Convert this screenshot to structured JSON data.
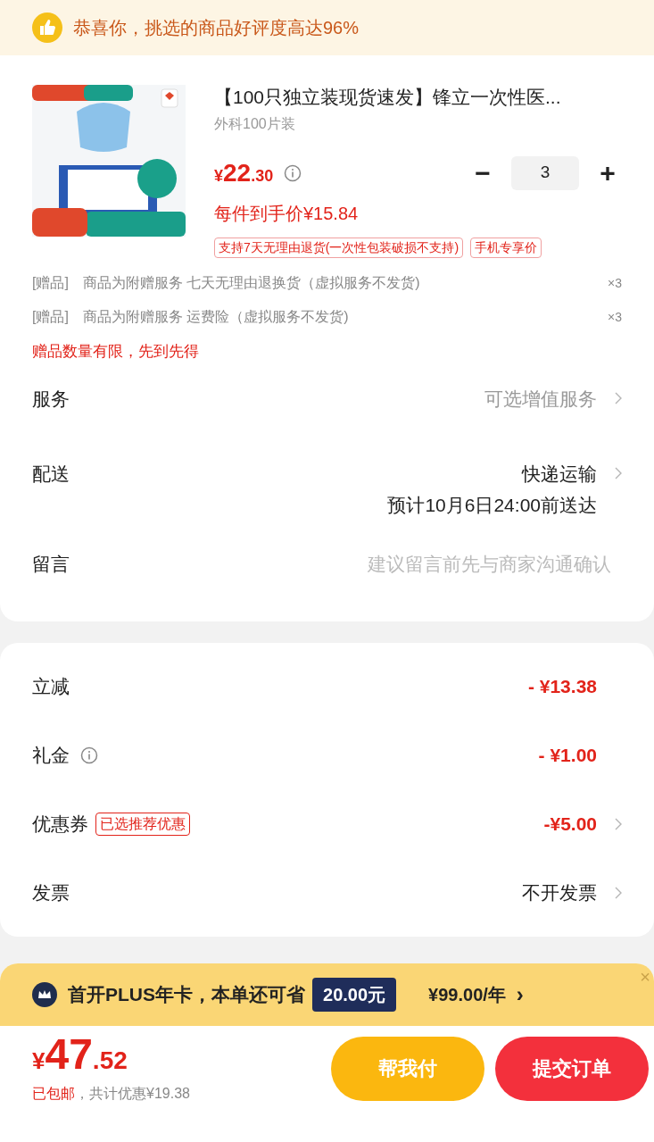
{
  "banner": {
    "text": "恭喜你，挑选的商品好评度高达96%"
  },
  "product": {
    "title": "【100只独立装现货速发】锋立一次性医...",
    "spec": "外科100片装",
    "price_symbol": "¥",
    "price_int": "22",
    "price_dec": ".30",
    "quantity": "3",
    "minus": "−",
    "plus": "+",
    "final_price": "每件到手价¥15.84",
    "tags": [
      "支持7天无理由退货(一次性包装破损不支持)",
      "手机专享价"
    ]
  },
  "gifts": [
    {
      "tag": "[赠品]",
      "text": "商品为附赠服务 七天无理由退换货（虚拟服务不发货)",
      "count": "×3"
    },
    {
      "tag": "[赠品]",
      "text": "商品为附赠服务 运费险（虚拟服务不发货)",
      "count": "×3"
    }
  ],
  "gift_note": "赠品数量有限，先到先得",
  "options": [
    {
      "label": "服务",
      "value": "可选增值服务",
      "arrow": true
    },
    {
      "label": "配送",
      "value": "快递运输",
      "sub": "预计10月6日24:00前送达",
      "arrow": true
    },
    {
      "label": "留言",
      "placeholder": "建议留言前先与商家沟通确认",
      "arrow": false
    }
  ],
  "discounts": [
    {
      "label": "立减",
      "value": "- ¥13.38",
      "kind": "amount",
      "info": false,
      "arrow": false
    },
    {
      "label": "礼金",
      "value": "- ¥1.00",
      "kind": "amount",
      "info": true,
      "arrow": false
    },
    {
      "label": "优惠券",
      "badge": "已选推荐优惠",
      "value": "-¥5.00",
      "kind": "amount",
      "info": false,
      "arrow": true
    },
    {
      "label": "发票",
      "value": "不开发票",
      "kind": "plain",
      "info": false,
      "arrow": true
    }
  ],
  "plus_bar": {
    "text": "首开PLUS年卡，本单还可省",
    "save": "20.00元",
    "price": "¥99.00/年",
    "chevron": "›",
    "close": "×"
  },
  "footer": {
    "symbol": "¥",
    "int": "47",
    "dec": ".52",
    "shipping": "已包邮",
    "discount": "，共计优惠¥19.38",
    "buttons": [
      {
        "label": "帮我付",
        "kind": "secondary"
      },
      {
        "label": "提交订单",
        "kind": "primary"
      }
    ]
  }
}
